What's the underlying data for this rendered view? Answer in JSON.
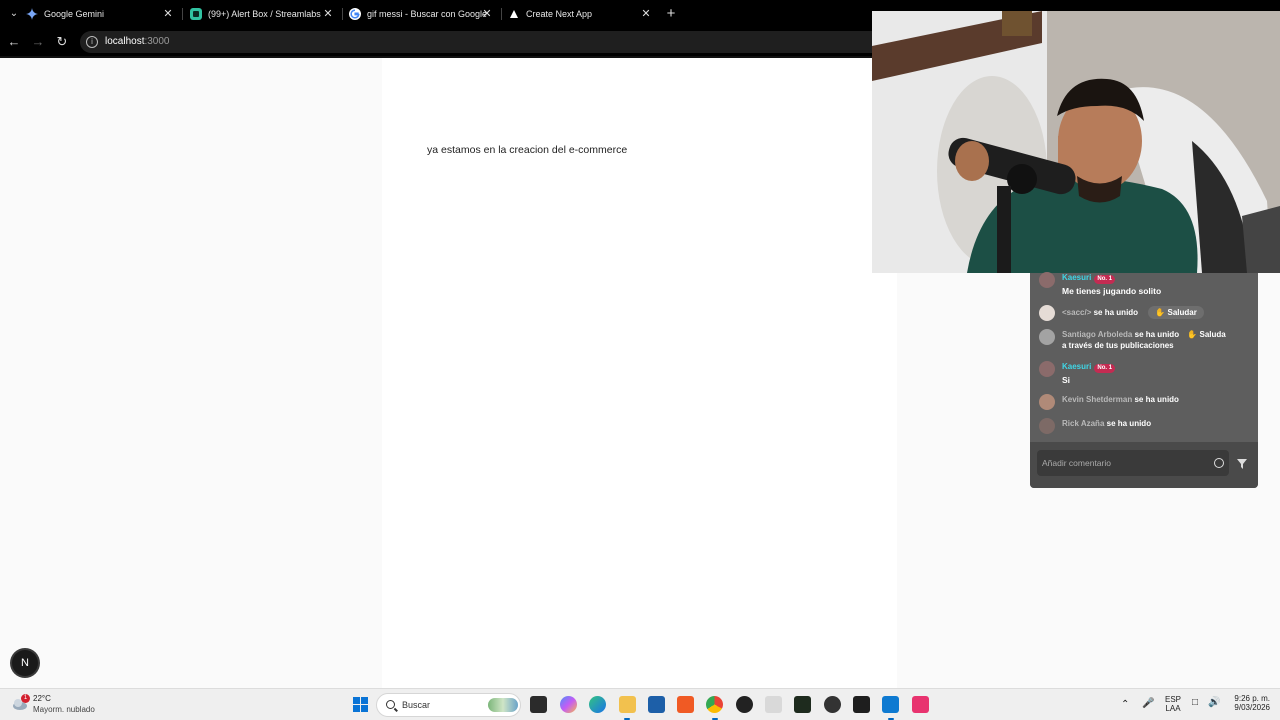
{
  "browser": {
    "tabs": [
      {
        "title": "Google Gemini",
        "icon": "gemini-icon"
      },
      {
        "title": "(99+) Alert Box / Streamlabs",
        "icon": "streamlabs-icon"
      },
      {
        "title": "gif messi - Buscar con Google",
        "icon": "google-icon"
      },
      {
        "title": "Create Next App",
        "icon": "nextjs-icon"
      }
    ],
    "url_host": "localhost",
    "url_port": ":3000"
  },
  "page": {
    "message": "ya estamos en la creacion del e-commerce",
    "next_badge": "N"
  },
  "chat": {
    "messages": [
      {
        "name": "Kaesuri",
        "badge": "No. 1",
        "text": "Me tienes jugando solito"
      },
      {
        "name": "<sacc/>",
        "action": "se ha unido",
        "button": "Saludar"
      },
      {
        "name": "Santiago Arboleda",
        "action": "se ha unido",
        "button": "Saluda",
        "sub": "a través de tus publicaciones"
      },
      {
        "name": "Kaesuri",
        "badge": "No. 1",
        "text": "Si"
      },
      {
        "name": "Kevin Shetderman",
        "action": "se ha unido"
      },
      {
        "name": "Rick Azaña",
        "action": "se ha unido"
      }
    ],
    "input_placeholder": "Añadir comentario"
  },
  "taskbar": {
    "weather_alert": "1",
    "temperature": "22°C",
    "condition": "Mayorm. nublado",
    "search_placeholder": "Buscar",
    "lang_top": "ESP",
    "lang_bottom": "LAA",
    "time": "9:26 p. m.",
    "date": "9/03/2026"
  }
}
